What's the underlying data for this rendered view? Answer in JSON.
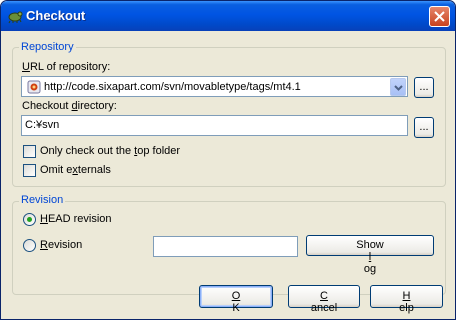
{
  "window": {
    "title": "Checkout"
  },
  "repository": {
    "group_label": "Repository",
    "url_label_pre": "",
    "url_label_key": "U",
    "url_label_post": "RL of repository:",
    "url_value": "http://code.sixapart.com/svn/movabletype/tags/mt4.1",
    "browse_label": "...",
    "dir_label_pre": "Checkout ",
    "dir_label_key": "d",
    "dir_label_post": "irectory:",
    "dir_value": "C:¥svn",
    "browse_dir_label": "...",
    "only_top_pre": "Only check out the ",
    "only_top_key": "t",
    "only_top_post": "op folder",
    "omit_pre": "Omit e",
    "omit_key": "x",
    "omit_post": "ternals"
  },
  "revision": {
    "group_label": "Revision",
    "head_pre": "",
    "head_key": "H",
    "head_post": "EAD revision",
    "rev_pre": "",
    "rev_key": "R",
    "rev_post": "evision",
    "rev_value": "",
    "show_log_pre": "Show ",
    "show_log_key": "l",
    "show_log_post": "og"
  },
  "buttons": {
    "ok_key": "O",
    "ok_post": "K",
    "cancel_key": "C",
    "cancel_post": "ancel",
    "help_key": "H",
    "help_post": "elp"
  },
  "colors": {
    "titlebar": "#0054e3",
    "accent_label": "#0046d5",
    "dialog_bg": "#ece9d8",
    "close_red": "#c8421d"
  }
}
